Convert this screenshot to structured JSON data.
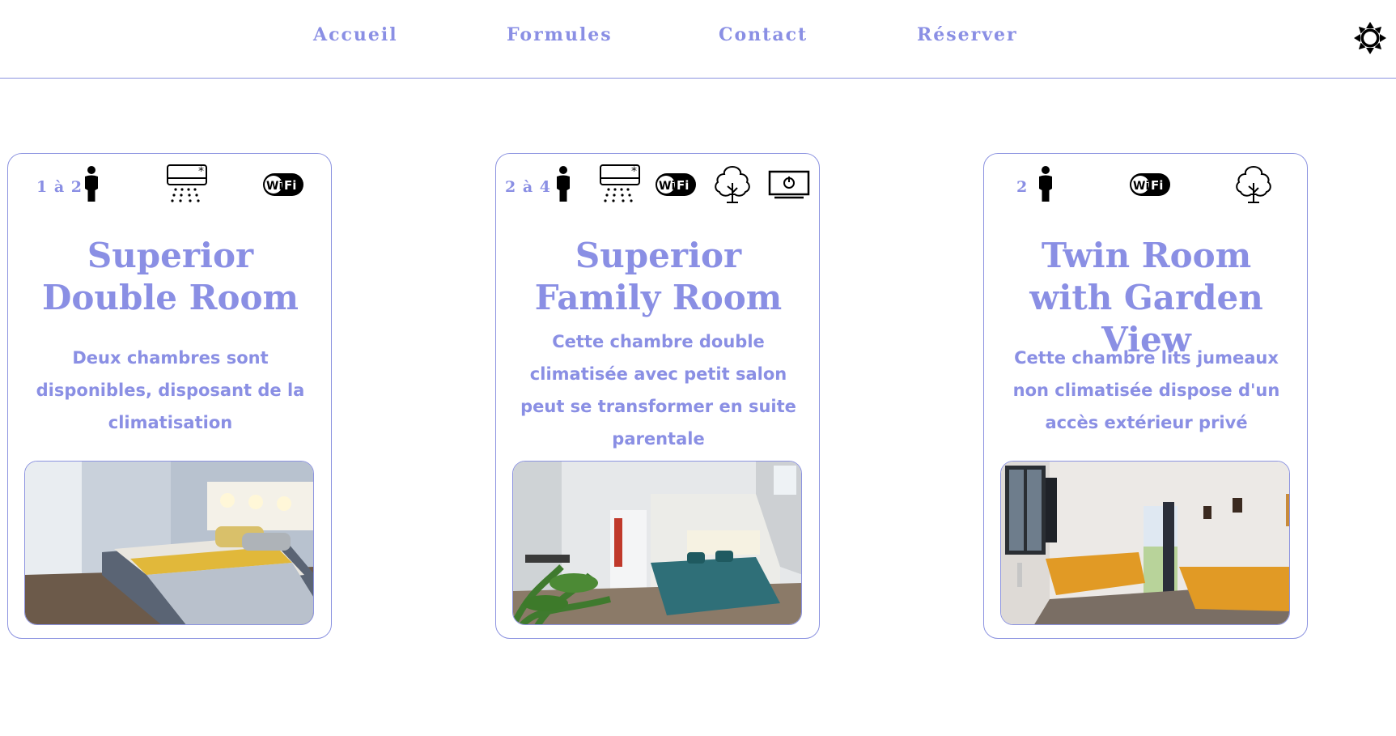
{
  "nav": {
    "links": [
      "Accueil",
      "Formules",
      "Contact",
      "Réserver"
    ],
    "theme_icon": "sun-icon"
  },
  "colors": {
    "accent": "#8a8fe4",
    "border": "#8c93e0",
    "icon": "#000000"
  },
  "rooms": [
    {
      "capacity": "1 à 2",
      "amenities": [
        "person-icon",
        "air-conditioning-icon",
        "wifi-icon"
      ],
      "title": "Superior Double Room",
      "description": "Deux chambres sont disponibles, disposant de la climatisation",
      "photo": "bedroom-photo"
    },
    {
      "capacity": "2 à 4",
      "amenities": [
        "person-icon",
        "air-conditioning-icon",
        "wifi-icon",
        "tree-icon",
        "tv-icon"
      ],
      "title": "Superior Family Room",
      "description": "Cette chambre double climatisée avec petit salon peut se transformer en suite parentale",
      "photo": "family-room-photo"
    },
    {
      "capacity": "2",
      "amenities": [
        "person-icon",
        "wifi-icon",
        "tree-icon"
      ],
      "title": "Twin Room with Garden View",
      "description": "Cette chambre lits jumeaux non climatisée dispose d'un accès extérieur privé",
      "photo": "twin-room-photo"
    }
  ]
}
